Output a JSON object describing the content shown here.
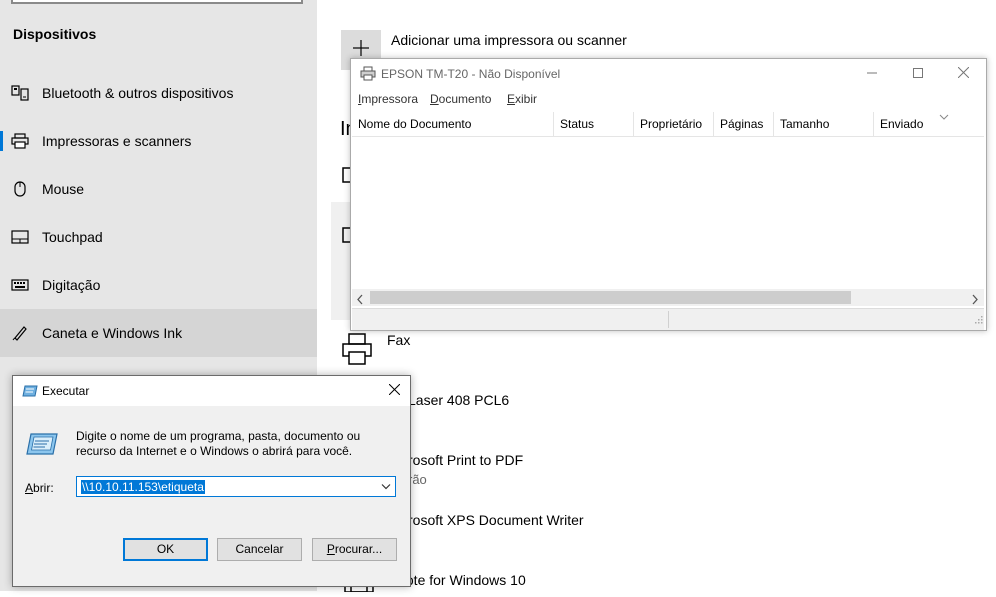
{
  "settings": {
    "section_title": "Dispositivos",
    "nav": [
      {
        "label": "Bluetooth & outros dispositivos",
        "icon": "bluetooth-devices-icon"
      },
      {
        "label": "Impressoras e scanners",
        "icon": "printer-icon"
      },
      {
        "label": "Mouse",
        "icon": "mouse-icon"
      },
      {
        "label": "Touchpad",
        "icon": "touchpad-icon"
      },
      {
        "label": "Digitação",
        "icon": "keyboard-icon"
      },
      {
        "label": "Caneta e Windows Ink",
        "icon": "pen-icon"
      }
    ],
    "add_printer_label": "Adicionar uma impressora ou scanner",
    "partial_heading": "In",
    "printers": [
      {
        "name": "Fax",
        "sub": ""
      },
      {
        "name": "Laser 408 PCL6",
        "sub": ""
      },
      {
        "name": "rosoft Print to PDF",
        "sub": "rão"
      },
      {
        "name": "rosoft XPS Document Writer",
        "sub": ""
      },
      {
        "name": "eNote for Windows 10",
        "sub": ""
      }
    ]
  },
  "queue_window": {
    "title": "EPSON TM-T20 - Não Disponível",
    "menu": [
      {
        "first": "I",
        "rest": "mpressora"
      },
      {
        "first": "D",
        "rest": "ocumento"
      },
      {
        "first": "E",
        "rest": "xibir"
      }
    ],
    "columns": [
      "Nome do Documento",
      "Status",
      "Proprietário",
      "Páginas",
      "Tamanho",
      "Enviado"
    ]
  },
  "run_dialog": {
    "title": "Executar",
    "description": "Digite o nome de um programa, pasta, documento ou recurso da Internet e o Windows o abrirá para você.",
    "open_label_first": "A",
    "open_label_rest": "brir:",
    "input_value": "\\\\10.10.11.153\\etiqueta",
    "ok_label": "OK",
    "cancel_label": "Cancelar",
    "browse_first": "P",
    "browse_rest": "rocurar..."
  },
  "colors": {
    "accent": "#0078d7",
    "sidebar_bg": "#e6e6e6",
    "dialog_bg": "#f0f0f0"
  }
}
